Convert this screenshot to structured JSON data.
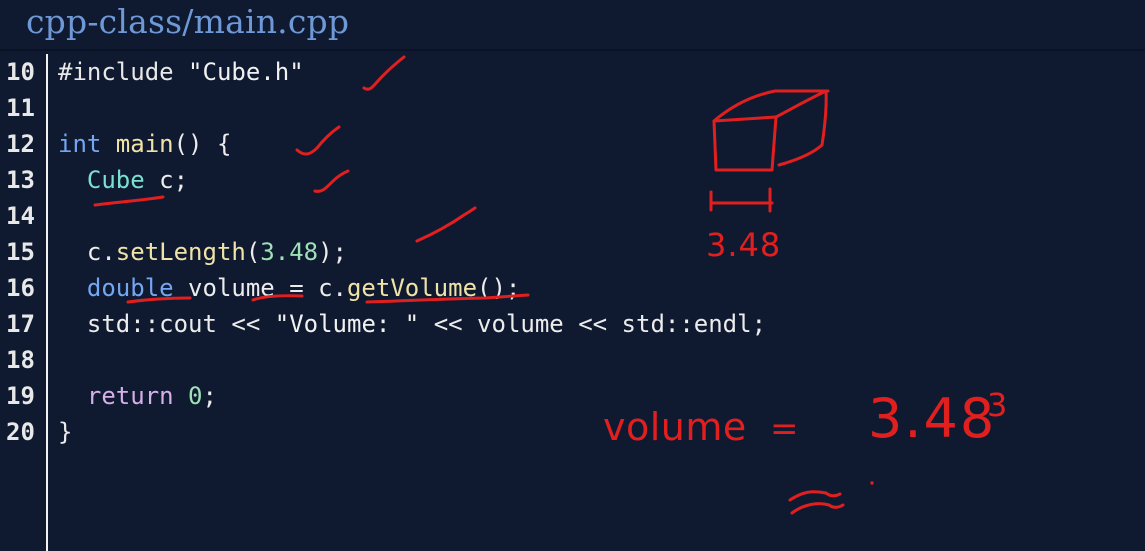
{
  "window": {
    "title": "cpp-class/main.cpp"
  },
  "editor": {
    "lines": [
      {
        "number": "10",
        "tokens": [
          {
            "text": "#include ",
            "kind": "kw"
          },
          {
            "text": "\"Cube.h\"",
            "kind": "str"
          }
        ]
      },
      {
        "number": "11",
        "tokens": []
      },
      {
        "number": "12",
        "tokens": [
          {
            "text": "int ",
            "kind": "type"
          },
          {
            "text": "main",
            "kind": "fn"
          },
          {
            "text": "() {",
            "kind": "plain"
          }
        ]
      },
      {
        "number": "13",
        "tokens": [
          {
            "text": "  Cube",
            "kind": "class"
          },
          {
            "text": " c;",
            "kind": "plain"
          }
        ]
      },
      {
        "number": "14",
        "tokens": []
      },
      {
        "number": "15",
        "tokens": [
          {
            "text": "  c.",
            "kind": "plain"
          },
          {
            "text": "setLength",
            "kind": "fn"
          },
          {
            "text": "(",
            "kind": "plain"
          },
          {
            "text": "3.48",
            "kind": "num"
          },
          {
            "text": ");",
            "kind": "plain"
          }
        ]
      },
      {
        "number": "16",
        "tokens": [
          {
            "text": "  double",
            "kind": "type"
          },
          {
            "text": " volume = c.",
            "kind": "plain"
          },
          {
            "text": "getVolume",
            "kind": "fn"
          },
          {
            "text": "();",
            "kind": "plain"
          }
        ]
      },
      {
        "number": "17",
        "tokens": [
          {
            "text": "  std::cout << ",
            "kind": "plain"
          },
          {
            "text": "\"Volume: \"",
            "kind": "str"
          },
          {
            "text": " << volume << std::endl;",
            "kind": "plain"
          }
        ]
      },
      {
        "number": "18",
        "tokens": []
      },
      {
        "number": "19",
        "tokens": [
          {
            "text": "  return",
            "kind": "ret"
          },
          {
            "text": " ",
            "kind": "plain"
          },
          {
            "text": "0",
            "kind": "num"
          },
          {
            "text": ";",
            "kind": "plain"
          }
        ]
      },
      {
        "number": "20",
        "tokens": [
          {
            "text": "}",
            "kind": "plain"
          }
        ]
      }
    ]
  },
  "annotations": {
    "ink_color": "#e11f1f",
    "cube_side_label": "3.48",
    "volume_label": "volume =",
    "volume_expression": "3.48",
    "exponent": "3",
    "approx_symbol": "≈"
  },
  "colors": {
    "background": "#0f1a31",
    "title": "#6e98d6",
    "type_keyword": "#74a7f2",
    "function": "#f0e3a8",
    "number": "#9fe0b7",
    "return_keyword": "#d6aee8",
    "class_name": "#7ce0d1"
  }
}
